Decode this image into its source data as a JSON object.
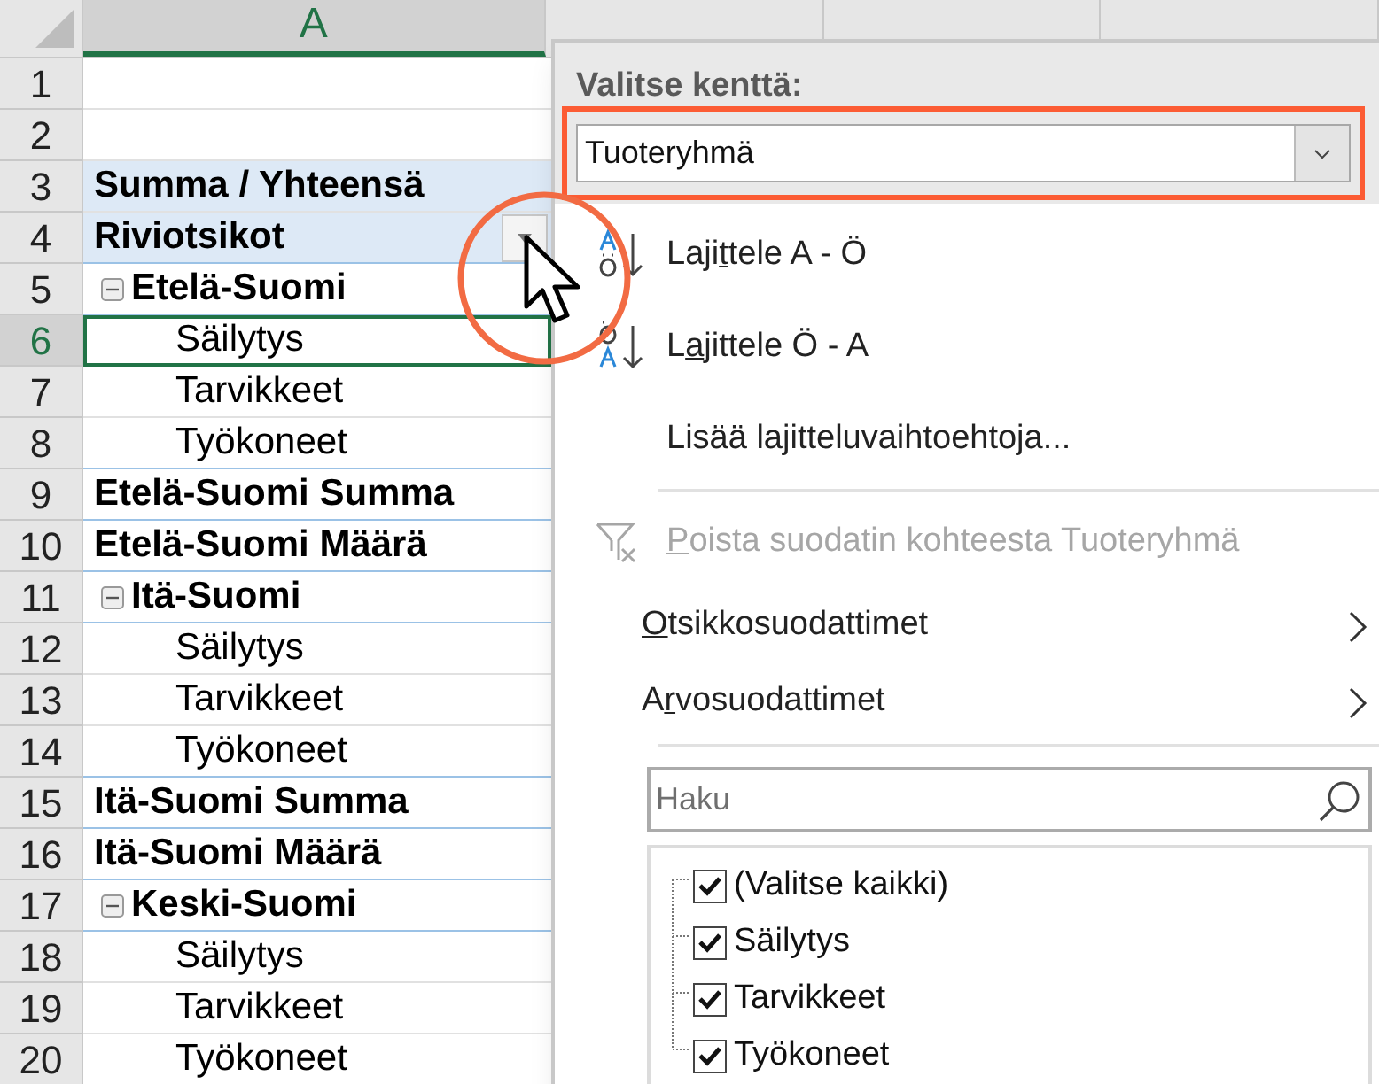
{
  "columns": [
    {
      "label": "A",
      "selected": true
    },
    {
      "selected": false
    },
    {
      "selected": false
    },
    {
      "selected": false
    }
  ],
  "rows": [
    {
      "number": "1",
      "kind": "empty",
      "selected": false
    },
    {
      "number": "2",
      "kind": "empty",
      "selected": false
    },
    {
      "number": "3",
      "kind": "header",
      "text": "Summa  / Yhteensä",
      "selected": false
    },
    {
      "number": "4",
      "kind": "header",
      "text": "Riviotsikot",
      "selected": false,
      "filter_button": true
    },
    {
      "number": "5",
      "kind": "group",
      "text": "Etelä-Suomi",
      "selected": false,
      "expanded": true
    },
    {
      "number": "6",
      "kind": "item",
      "text": "Säilytys",
      "selected": true
    },
    {
      "number": "7",
      "kind": "item",
      "text": "Tarvikkeet",
      "selected": false
    },
    {
      "number": "8",
      "kind": "item",
      "text": "Työkoneet",
      "selected": false
    },
    {
      "number": "9",
      "kind": "total",
      "text": "Etelä-Suomi Summa",
      "selected": false
    },
    {
      "number": "10",
      "kind": "total",
      "text": "Etelä-Suomi Määrä",
      "selected": false
    },
    {
      "number": "11",
      "kind": "group",
      "text": "Itä-Suomi",
      "selected": false,
      "expanded": true
    },
    {
      "number": "12",
      "kind": "item",
      "text": "Säilytys",
      "selected": false
    },
    {
      "number": "13",
      "kind": "item",
      "text": "Tarvikkeet",
      "selected": false
    },
    {
      "number": "14",
      "kind": "item",
      "text": "Työkoneet",
      "selected": false
    },
    {
      "number": "15",
      "kind": "total",
      "text": "Itä-Suomi Summa",
      "selected": false
    },
    {
      "number": "16",
      "kind": "total",
      "text": "Itä-Suomi Määrä",
      "selected": false
    },
    {
      "number": "17",
      "kind": "group",
      "text": "Keski-Suomi",
      "selected": false,
      "expanded": true
    },
    {
      "number": "18",
      "kind": "item",
      "text": "Säilytys",
      "selected": false
    },
    {
      "number": "19",
      "kind": "item",
      "text": "Tarvikkeet",
      "selected": false
    },
    {
      "number": "20",
      "kind": "item",
      "text": "Työkoneet",
      "selected": false
    }
  ],
  "filter_menu": {
    "field_label": "Valitse kenttä:",
    "field_value": "Tuoteryhmä",
    "items": [
      {
        "kind": "sort_asc",
        "before": "Laji",
        "key": "t",
        "after": "tele A - Ö",
        "disabled": false
      },
      {
        "kind": "sort_desc",
        "before": "L",
        "key": "a",
        "after": "jittele Ö - A",
        "disabled": false
      },
      {
        "kind": "plain",
        "before": "Lisää la",
        "key": "j",
        "after": "itteluvaihtoehtoja...",
        "disabled": false
      },
      {
        "kind": "separator"
      },
      {
        "kind": "clear_filter",
        "key": "P",
        "after": "oista suodatin kohteesta Tuoteryhmä",
        "disabled": true
      },
      {
        "kind": "submenu",
        "key": "O",
        "after": "tsikkosuodattimet",
        "disabled": false
      },
      {
        "kind": "submenu",
        "before": "A",
        "key": "r",
        "after": "vosuodattimet",
        "disabled": false
      },
      {
        "kind": "separator"
      }
    ],
    "search": {
      "placeholder": "Haku"
    },
    "values": [
      {
        "label": "(Valitse kaikki)",
        "checked": true
      },
      {
        "label": "Säilytys",
        "checked": true
      },
      {
        "label": "Tarvikkeet",
        "checked": true
      },
      {
        "label": "Työkoneet",
        "checked": true
      }
    ]
  }
}
